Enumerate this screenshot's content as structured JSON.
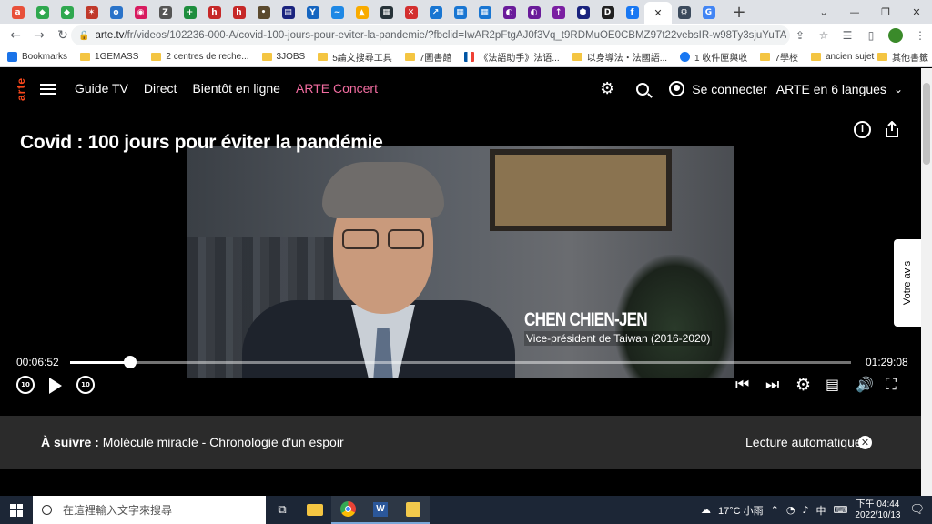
{
  "browser": {
    "tabs": [
      {
        "icon": "arte-tab-icon",
        "color": "#e8503a",
        "glyph": "a"
      },
      {
        "icon": "green-leaf-icon",
        "color": "#2fa84f",
        "glyph": "◆"
      },
      {
        "icon": "green-leaf-icon",
        "color": "#2fa84f",
        "glyph": "◆"
      },
      {
        "icon": "star-icon",
        "color": "#c0392b",
        "glyph": "✶"
      },
      {
        "icon": "outlook-icon",
        "color": "#2a73c9",
        "glyph": "o"
      },
      {
        "icon": "pink-icon",
        "color": "#d81b60",
        "glyph": "◉"
      },
      {
        "icon": "z-icon",
        "color": "#555555",
        "glyph": "Z"
      },
      {
        "icon": "plus-icon",
        "color": "#1e8e3e",
        "glyph": "+"
      },
      {
        "icon": "h-icon",
        "color": "#c62828",
        "glyph": "h"
      },
      {
        "icon": "h-icon",
        "color": "#c62828",
        "glyph": "h"
      },
      {
        "icon": "dark-icon",
        "color": "#5b4a2e",
        "glyph": "•"
      },
      {
        "icon": "news-icon",
        "color": "#1a237e",
        "glyph": "▤"
      },
      {
        "icon": "y-icon",
        "color": "#1565c0",
        "glyph": "Y"
      },
      {
        "icon": "wave-icon",
        "color": "#1e88e5",
        "glyph": "~"
      },
      {
        "icon": "drive-icon",
        "color": "#f9ab00",
        "glyph": "▲"
      },
      {
        "icon": "film-icon",
        "color": "#263238",
        "glyph": "▦"
      },
      {
        "icon": "x-red-icon",
        "color": "#d32f2f",
        "glyph": "✕"
      },
      {
        "icon": "arrow-icon",
        "color": "#1976d2",
        "glyph": "↗"
      },
      {
        "icon": "grid-icon",
        "color": "#1976d2",
        "glyph": "▦"
      },
      {
        "icon": "grid-icon",
        "color": "#1976d2",
        "glyph": "▦"
      },
      {
        "icon": "purple-icon",
        "color": "#6a1b9a",
        "glyph": "◐"
      },
      {
        "icon": "purple-icon",
        "color": "#6a1b9a",
        "glyph": "◐"
      },
      {
        "icon": "pin-icon",
        "color": "#7b1fa2",
        "glyph": "↑"
      },
      {
        "icon": "hex-icon",
        "color": "#1a237e",
        "glyph": "⬢"
      },
      {
        "icon": "d-icon",
        "color": "#212121",
        "glyph": "D"
      },
      {
        "icon": "facebook-icon",
        "color": "#1877f2",
        "glyph": "f"
      }
    ],
    "active_tab": {
      "icon": "arte-dots-icon",
      "close": "✕"
    },
    "after_active": [
      {
        "icon": "settings-tab-icon",
        "color": "#3c4a5c",
        "glyph": "⚙"
      },
      {
        "icon": "google-icon",
        "color": "#4285f4",
        "glyph": "G"
      }
    ],
    "new_tab": "+",
    "window_controls": {
      "menu": "⌄",
      "minimize": "—",
      "restore": "❐",
      "close": "✕"
    },
    "url_host": "arte.tv",
    "url_path": "/fr/videos/102236-000-A/covid-100-jours-pour-eviter-la-pandemie/?fbclid=IwAR2pFtgAJ0f3Vq_t9RDMuOE0CBMZ97t22vebsIR-w98Ty3sjuYuTAV...",
    "bookmarks": [
      {
        "label": "Bookmarks",
        "type": "star"
      },
      {
        "label": "1GEMASS",
        "type": "folder"
      },
      {
        "label": "2 centres de reche...",
        "type": "folder"
      },
      {
        "label": "3JOBS",
        "type": "folder"
      },
      {
        "label": "5論文搜尋工具",
        "type": "folder"
      },
      {
        "label": "7圖書館",
        "type": "folder"
      },
      {
        "label": "《法語助手》法语...",
        "type": "flag"
      },
      {
        "label": "以身導法・法國語...",
        "type": "folder"
      },
      {
        "label": "1 收件匣與收",
        "type": "facebook"
      },
      {
        "label": "7學校",
        "type": "folder"
      },
      {
        "label": "ancien sujet",
        "type": "folder"
      }
    ],
    "bookmarks_more": "»",
    "bookmarks_other": "其他書籤"
  },
  "arte": {
    "logo": "arte",
    "nav": [
      "Guide TV",
      "Direct",
      "Bientôt en ligne",
      "ARTE Concert"
    ],
    "login": "Se connecter",
    "languages": "ARTE en 6 langues",
    "title": "Covid : 100 jours pour éviter la pandémie",
    "lower_third": {
      "name": "CHEN CHIEN-JEN",
      "role": "Vice-président de Taiwan (2016-2020)"
    },
    "feedback": "Votre avis",
    "player": {
      "current_time": "00:06:52",
      "total_time": "01:29:08",
      "progress_fraction": 0.077,
      "skip_back": "10",
      "skip_fwd": "10"
    },
    "next": {
      "label": "À suivre :",
      "title": "Molécule miracle - Chronologie d'un espoir"
    },
    "autoplay": "Lecture automatique"
  },
  "taskbar": {
    "search_placeholder": "在這裡輸入文字來搜尋",
    "weather": "17°C 小雨",
    "ime": "中",
    "time": "下午 04:44",
    "date": "2022/10/13"
  }
}
